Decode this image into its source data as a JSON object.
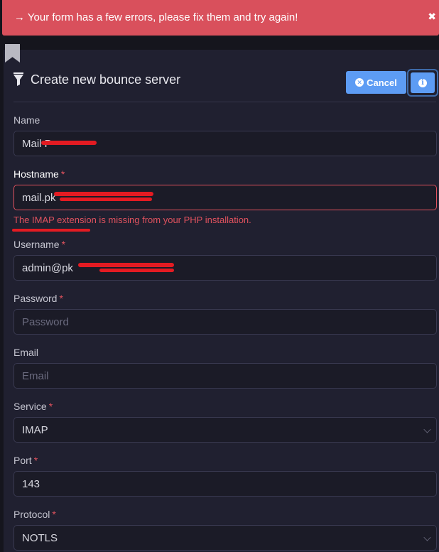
{
  "alert": {
    "text": "→ Your form has a few errors, please fix them and try again!",
    "close_icon": "✖"
  },
  "header": {
    "title": "Create new bounce server",
    "cancel_label": "Cancel",
    "filter_icon": "filter-icon",
    "info_icon": "info-icon"
  },
  "form": {
    "name": {
      "label": "Name",
      "value": "Mail P"
    },
    "hostname": {
      "label": "Hostname",
      "value": "mail.pk",
      "error": "The IMAP extension is missing from your PHP installation."
    },
    "username": {
      "label": "Username",
      "value": "admin@pk"
    },
    "password": {
      "label": "Password",
      "placeholder": "Password"
    },
    "email": {
      "label": "Email",
      "placeholder": "Email"
    },
    "service": {
      "label": "Service",
      "value": "IMAP"
    },
    "port": {
      "label": "Port",
      "value": "143"
    },
    "protocol": {
      "label": "Protocol",
      "value": "NOTLS"
    },
    "required_mark": "*"
  },
  "colors": {
    "alert_bg": "#d9505c",
    "accent": "#5d9cf4",
    "error": "#e0525e",
    "panel_bg": "#202030",
    "redaction": "#e31b22"
  }
}
